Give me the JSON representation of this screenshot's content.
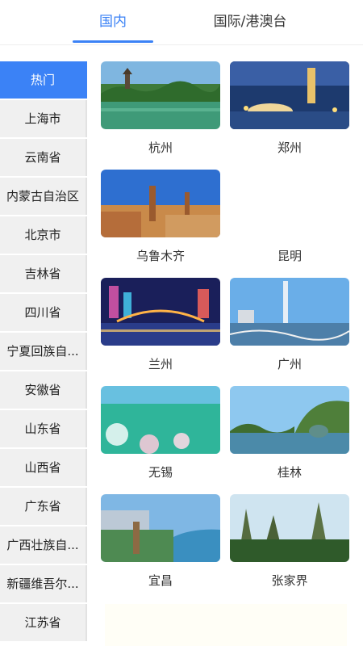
{
  "tabs": [
    {
      "label": "国内",
      "active": true
    },
    {
      "label": "国际/港澳台",
      "active": false
    }
  ],
  "sidebar": {
    "items": [
      {
        "label": "热门",
        "active": true
      },
      {
        "label": "上海市"
      },
      {
        "label": "云南省"
      },
      {
        "label": "内蒙古自治区"
      },
      {
        "label": "北京市"
      },
      {
        "label": "吉林省"
      },
      {
        "label": "四川省"
      },
      {
        "label": "宁夏回族自..."
      },
      {
        "label": "安徽省"
      },
      {
        "label": "山东省"
      },
      {
        "label": "山西省"
      },
      {
        "label": "广东省"
      },
      {
        "label": "广西壮族自..."
      },
      {
        "label": "新疆维吾尔..."
      },
      {
        "label": "江苏省"
      }
    ]
  },
  "cities": [
    {
      "name": "杭州"
    },
    {
      "name": "郑州"
    },
    {
      "name": "乌鲁木齐"
    },
    {
      "name": "昆明"
    },
    {
      "name": "兰州"
    },
    {
      "name": "广州"
    },
    {
      "name": "无锡"
    },
    {
      "name": "桂林"
    },
    {
      "name": "宜昌"
    },
    {
      "name": "张家界"
    }
  ],
  "colors": {
    "accent": "#3b82f6",
    "sidebar_bg": "#f0f0f0"
  }
}
